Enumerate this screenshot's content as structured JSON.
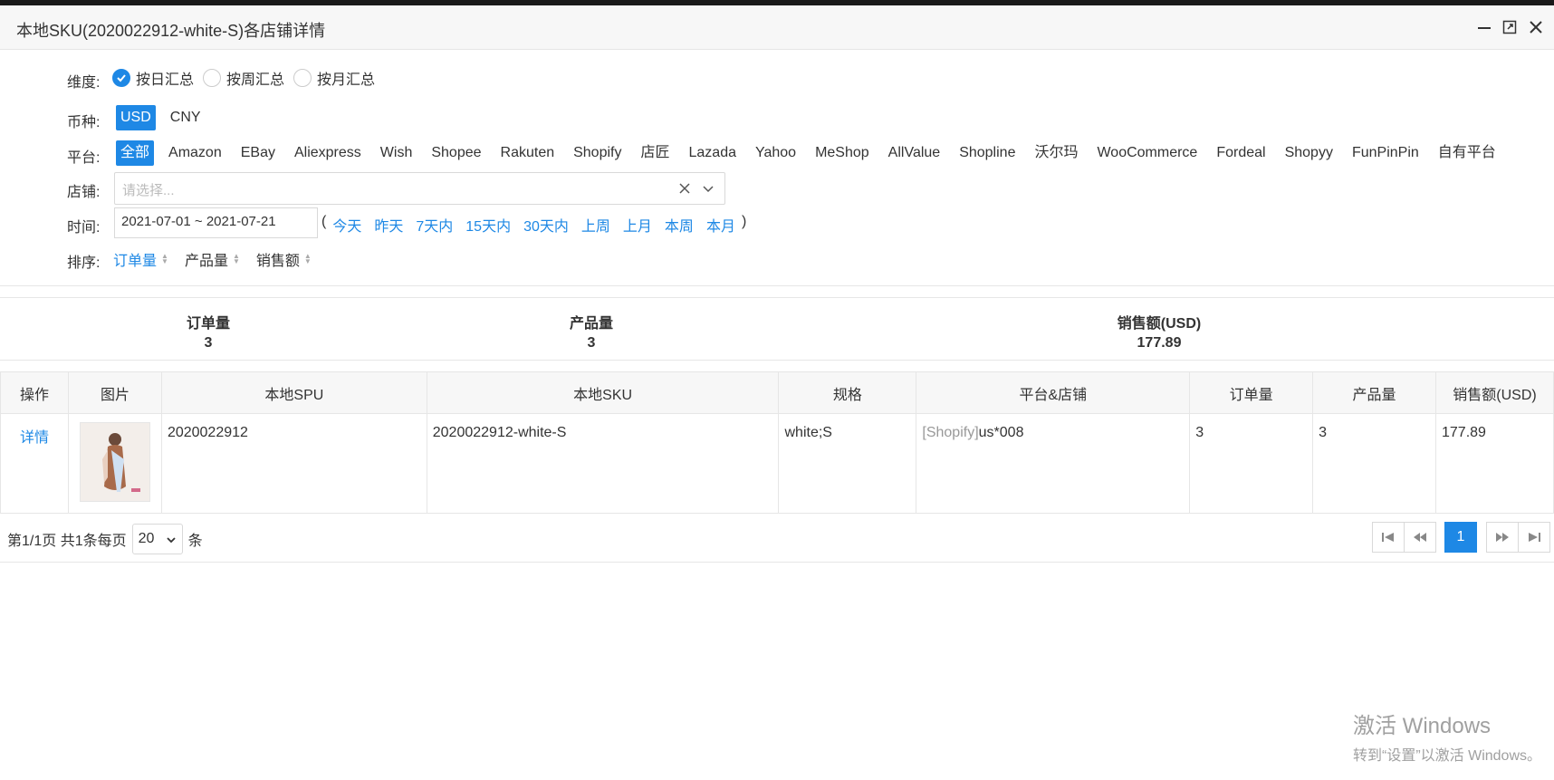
{
  "window": {
    "title": "本地SKU(2020022912-white-S)各店铺详情"
  },
  "filters": {
    "dimension": {
      "label": "维度:",
      "options": [
        "按日汇总",
        "按周汇总",
        "按月汇总"
      ],
      "selected": "按日汇总"
    },
    "currency": {
      "label": "币种:",
      "options": [
        "USD",
        "CNY"
      ],
      "selected": "USD"
    },
    "platform": {
      "label": "平台:",
      "options": [
        "全部",
        "Amazon",
        "EBay",
        "Aliexpress",
        "Wish",
        "Shopee",
        "Rakuten",
        "Shopify",
        "店匠",
        "Lazada",
        "Yahoo",
        "MeShop",
        "AllValue",
        "Shopline",
        "沃尔玛",
        "WooCommerce",
        "Fordeal",
        "Shopyy",
        "FunPinPin",
        "自有平台"
      ],
      "selected": "全部"
    },
    "store": {
      "label": "店铺:",
      "placeholder": "请选择..."
    },
    "time": {
      "label": "时间:",
      "value": "2021-07-01 ~ 2021-07-21",
      "open_paren": "(",
      "close_paren": ")",
      "quick": [
        "今天",
        "昨天",
        "7天内",
        "15天内",
        "30天内",
        "上周",
        "上月",
        "本周",
        "本月"
      ]
    },
    "sort": {
      "label": "排序:",
      "options": [
        "订单量",
        "产品量",
        "销售额"
      ],
      "selected": "订单量"
    }
  },
  "summary": {
    "orders": {
      "label": "订单量",
      "value": "3"
    },
    "products": {
      "label": "产品量",
      "value": "3"
    },
    "sales": {
      "label": "销售额(USD)",
      "value": "177.89"
    }
  },
  "table": {
    "headers": [
      "操作",
      "图片",
      "本地SPU",
      "本地SKU",
      "规格",
      "平台&店铺",
      "订单量",
      "产品量",
      "销售额(USD)"
    ],
    "rows": [
      {
        "action": "详情",
        "spu": "2020022912",
        "sku": "2020022912-white-S",
        "spec": "white;S",
        "platform_tag": "[Shopify]",
        "store": "us*008",
        "orders": "3",
        "products": "3",
        "sales": "177.89"
      }
    ]
  },
  "pager": {
    "info": "第1/1页 共1条每页",
    "page_size": "20",
    "unit": "条",
    "current_page": "1"
  },
  "watermark": {
    "line1": "激活 Windows",
    "line2": "转到“设置”以激活 Windows。"
  },
  "colors": {
    "accent": "#1e88e5",
    "border": "#e6e6e6",
    "header_bg": "#f7f7f7"
  }
}
